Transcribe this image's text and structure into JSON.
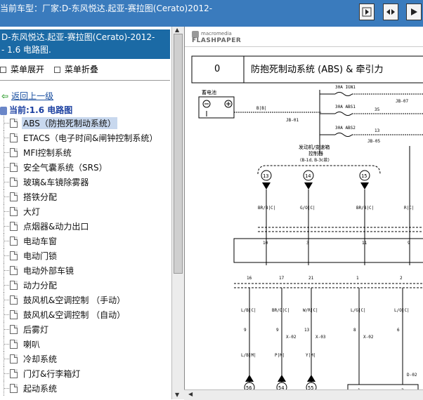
{
  "window": {
    "title": "当前车型：厂家:D-东风悦达.起亚-赛拉图(Cerato)2012-"
  },
  "toolbar": {
    "buttons": [
      {
        "name": "forward-button",
        "icon": "next-page-icon"
      },
      {
        "name": "fit-width-button",
        "icon": "fit-icon"
      },
      {
        "name": "fullscreen-button",
        "icon": "expand-icon"
      }
    ]
  },
  "sidebar": {
    "doc_title_line1": "D-东风悦达.起亚-赛拉图(Cerato)-2012-",
    "doc_title_line2": "- 1.6 电路图.",
    "expand_label": "菜单展开",
    "collapse_label": "菜单折叠",
    "back_label": "返回上一级",
    "current_label": "当前:1.6 电路图",
    "items": [
      {
        "label": "ABS（防抱死制动系统）",
        "selected": true
      },
      {
        "label": "ETACS（电子时间&闸钟控制系统）"
      },
      {
        "label": "MFI控制系统"
      },
      {
        "label": "安全气囊系统（SRS）"
      },
      {
        "label": "玻璃&车镜除雾器"
      },
      {
        "label": "搭铁分配"
      },
      {
        "label": "大灯"
      },
      {
        "label": "点烟器&动力出口"
      },
      {
        "label": "电动车窗"
      },
      {
        "label": "电动门锁"
      },
      {
        "label": "电动外部车镜"
      },
      {
        "label": "动力分配"
      },
      {
        "label": "鼓风机&空调控制 （手动）"
      },
      {
        "label": "鼓风机&空调控制 （自动）"
      },
      {
        "label": "后雾灯"
      },
      {
        "label": "喇叭"
      },
      {
        "label": "冷却系统"
      },
      {
        "label": "门灯&行李箱灯"
      },
      {
        "label": "起动系统"
      }
    ]
  },
  "viewer": {
    "logo_small": "macromedia",
    "logo_big": "FLASHPAPER",
    "page_number": "0",
    "page_title": "防抱死制动系统 (ABS) & 牵引力",
    "battery_label": "蓄电池",
    "fuses": [
      {
        "label": "30A IGN1"
      },
      {
        "label": "30A ABS1"
      },
      {
        "label": "30A ABS2"
      }
    ],
    "connector_labels": [
      "JB-07",
      "JB-01",
      "JB-05",
      "35",
      "13",
      "1"
    ],
    "wire_main": "B|B|",
    "ecu_label_line1": "发动机/变速箱",
    "ecu_label_line2": "控制器",
    "ecu_label_line3": "(B-1d, B-3c款)",
    "circle_pins": [
      "13",
      "14",
      "15"
    ],
    "wire_codes_top": [
      "BR/B|C|",
      "G/O|C|",
      "BR/B|C|",
      "R|C|"
    ],
    "pin_nums_top": [
      "10",
      "3",
      "11",
      "9"
    ],
    "pin_nums_mid": [
      "16",
      "17",
      "21",
      "1",
      "2"
    ],
    "wire_codes_mid": [
      "L/B|C|",
      "BR/O|C|",
      "W/R|C|",
      "L/G|C|",
      "L/O|C|"
    ],
    "x_labels": [
      "X-02",
      "X-03",
      "X-02",
      "D-02"
    ],
    "small_nums": [
      "9",
      "9",
      "13",
      "8",
      "6"
    ],
    "wire_codes_low": [
      "L/B|M|",
      "P|M|",
      "Y|M|"
    ],
    "bottom_pins": [
      "56",
      "54",
      "55"
    ],
    "bottom_box_pins": [
      "1",
      "2"
    ]
  }
}
